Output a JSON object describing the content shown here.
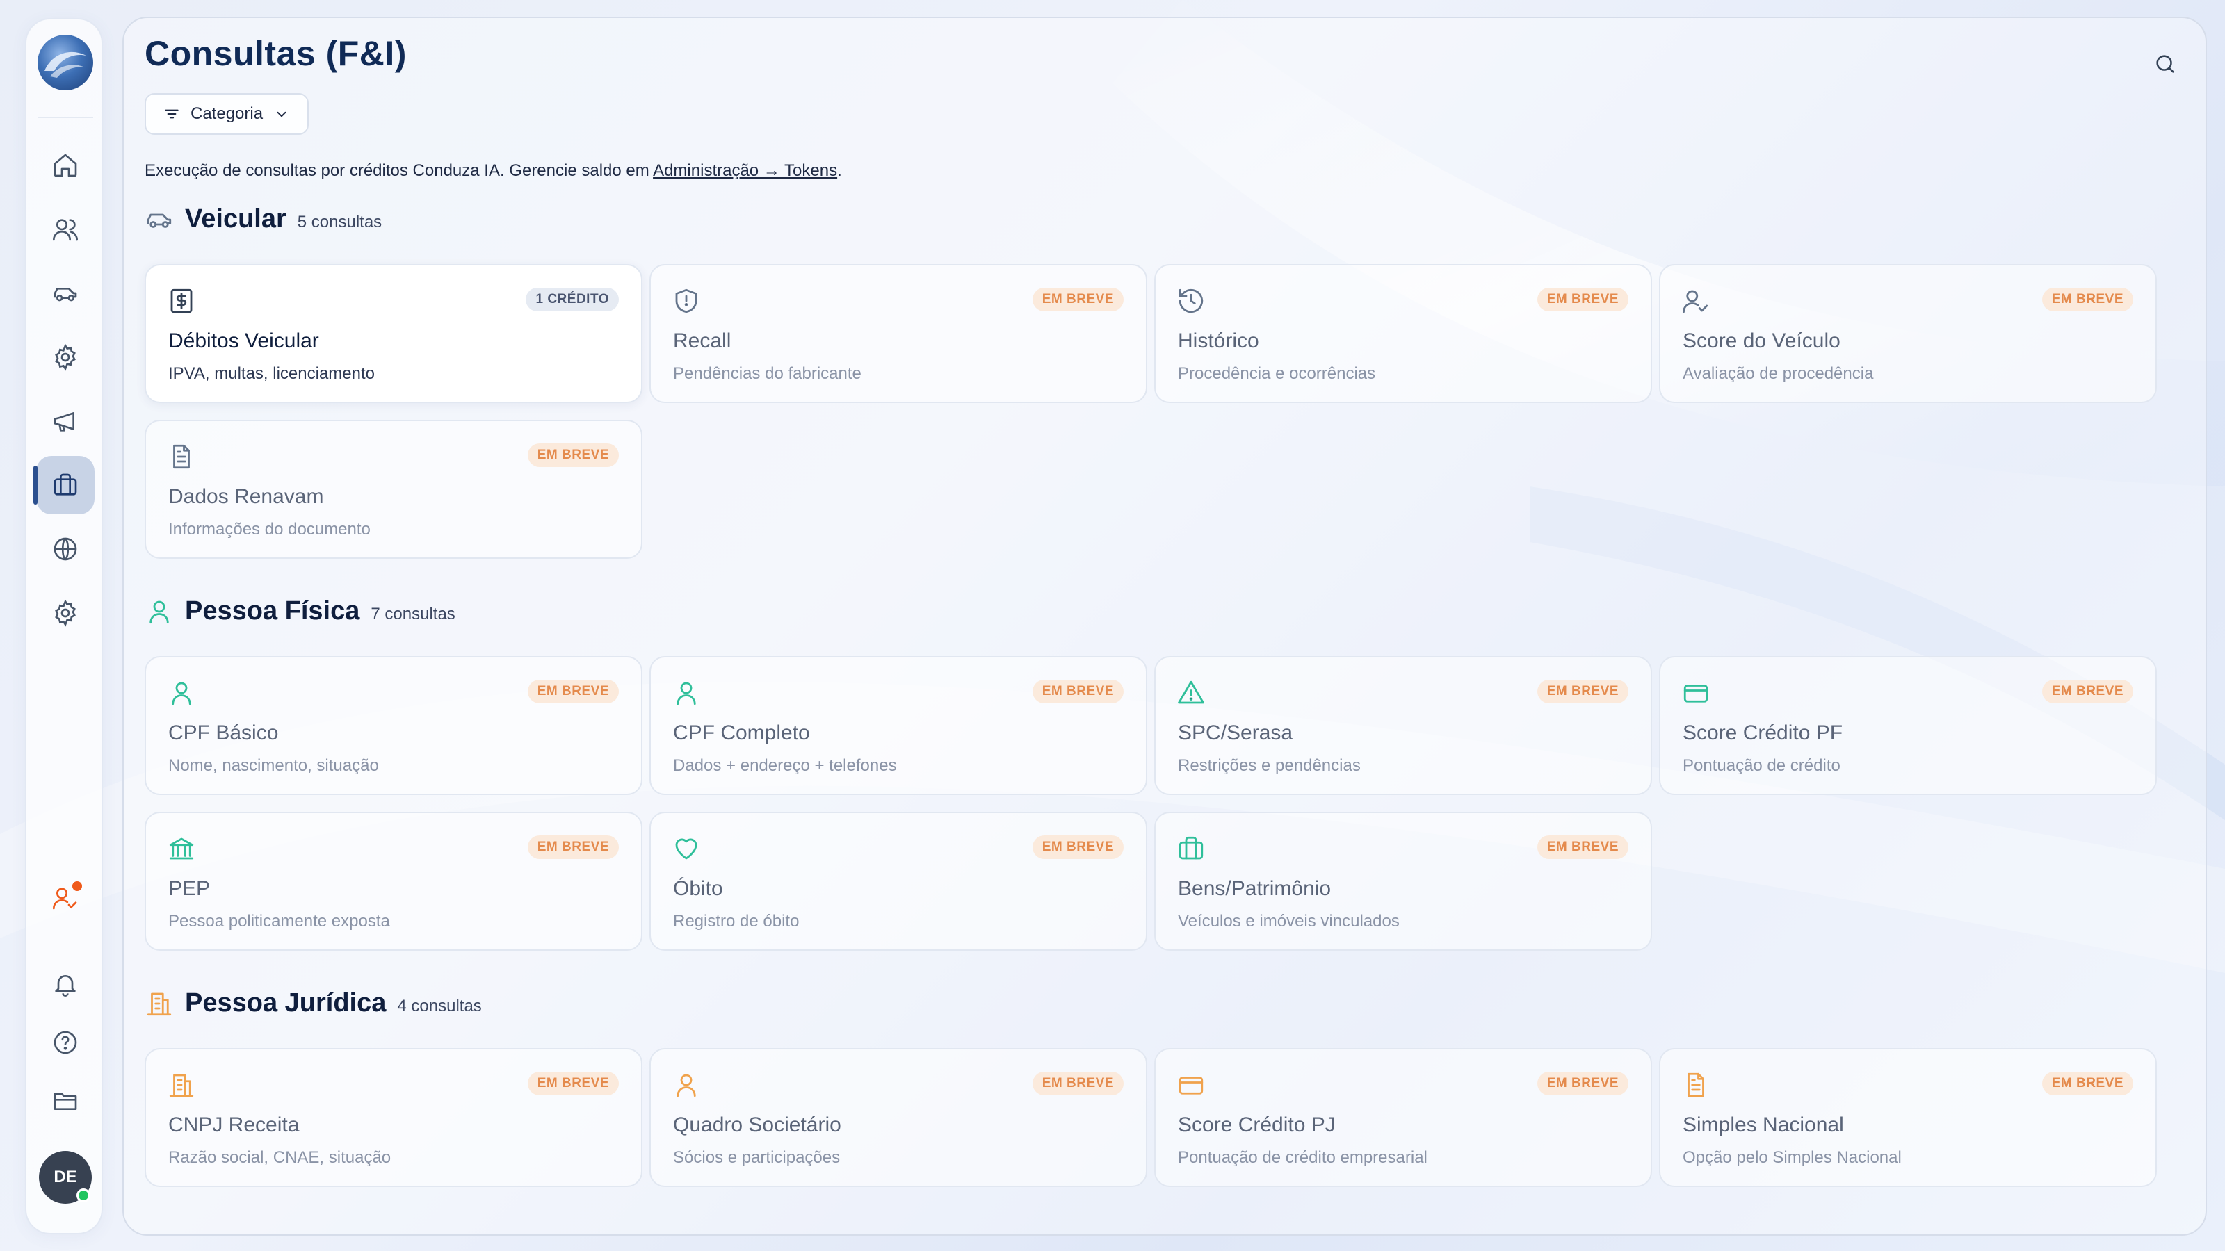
{
  "colors": {
    "vehicle": "#64748b",
    "person": "#2fbf9a",
    "company": "#f0a24c",
    "badge_soon_bg": "#fbeadc",
    "badge_soon_text": "#e48a4c",
    "active_nav": "#2b4f8f"
  },
  "sidebar": {
    "items": [
      {
        "icon": "home-icon"
      },
      {
        "icon": "users-icon"
      },
      {
        "icon": "car-icon"
      },
      {
        "icon": "gear-icon"
      },
      {
        "icon": "megaphone-icon"
      },
      {
        "icon": "briefcase-icon",
        "active": true
      },
      {
        "icon": "globe-icon"
      },
      {
        "icon": "gear-icon"
      },
      {
        "icon": "user-check-icon",
        "notification": true
      },
      {
        "icon": "bell-icon"
      },
      {
        "icon": "help-icon"
      },
      {
        "icon": "folder-icon"
      }
    ],
    "avatar_initials": "DE"
  },
  "header": {
    "title": "Consultas (F&I)",
    "filter_label": "Categoria",
    "description_prefix": "Execução de consultas por créditos Conduza IA. Gerencie saldo em ",
    "description_link": "Administração → Tokens",
    "description_suffix": "."
  },
  "sections": [
    {
      "title": "Veicular",
      "count": "5 consultas",
      "icon": "car-icon",
      "cards": [
        {
          "title": "Débitos Veicular",
          "subtitle": "IPVA, multas, licenciamento",
          "badge": "1 CRÉDITO",
          "icon": "dollar-doc-icon",
          "enabled": true
        },
        {
          "title": "Recall",
          "subtitle": "Pendências do fabricante",
          "badge": "EM BREVE",
          "icon": "shield-icon"
        },
        {
          "title": "Histórico",
          "subtitle": "Procedência e ocorrências",
          "badge": "EM BREVE",
          "icon": "history-icon"
        },
        {
          "title": "Score do Veículo",
          "subtitle": "Avaliação de procedência",
          "badge": "EM BREVE",
          "icon": "user-check-icon"
        },
        {
          "title": "Dados Renavam",
          "subtitle": "Informações do documento",
          "badge": "EM BREVE",
          "icon": "document-icon"
        }
      ]
    },
    {
      "title": "Pessoa Física",
      "count": "7 consultas",
      "icon": "user-icon",
      "cards": [
        {
          "title": "CPF Básico",
          "subtitle": "Nome, nascimento, situação",
          "badge": "EM BREVE",
          "icon": "user-icon"
        },
        {
          "title": "CPF Completo",
          "subtitle": "Dados + endereço + telefones",
          "badge": "EM BREVE",
          "icon": "user-icon"
        },
        {
          "title": "SPC/Serasa",
          "subtitle": "Restrições e pendências",
          "badge": "EM BREVE",
          "icon": "warning-icon"
        },
        {
          "title": "Score Crédito PF",
          "subtitle": "Pontuação de crédito",
          "badge": "EM BREVE",
          "icon": "credit-card-icon"
        },
        {
          "title": "PEP",
          "subtitle": "Pessoa politicamente exposta",
          "badge": "EM BREVE",
          "icon": "bank-icon"
        },
        {
          "title": "Óbito",
          "subtitle": "Registro de óbito",
          "badge": "EM BREVE",
          "icon": "heart-icon"
        },
        {
          "title": "Bens/Patrimônio",
          "subtitle": "Veículos e imóveis vinculados",
          "badge": "EM BREVE",
          "icon": "briefcase-icon"
        }
      ]
    },
    {
      "title": "Pessoa Jurídica",
      "count": "4 consultas",
      "icon": "building-icon",
      "cards": [
        {
          "title": "CNPJ Receita",
          "subtitle": "Razão social, CNAE, situação",
          "badge": "EM BREVE",
          "icon": "building-icon"
        },
        {
          "title": "Quadro Societário",
          "subtitle": "Sócios e participações",
          "badge": "EM BREVE",
          "icon": "user-icon"
        },
        {
          "title": "Score Crédito PJ",
          "subtitle": "Pontuação de crédito empresarial",
          "badge": "EM BREVE",
          "icon": "credit-card-icon"
        },
        {
          "title": "Simples Nacional",
          "subtitle": "Opção pelo Simples Nacional",
          "badge": "EM BREVE",
          "icon": "document-icon"
        }
      ]
    }
  ]
}
